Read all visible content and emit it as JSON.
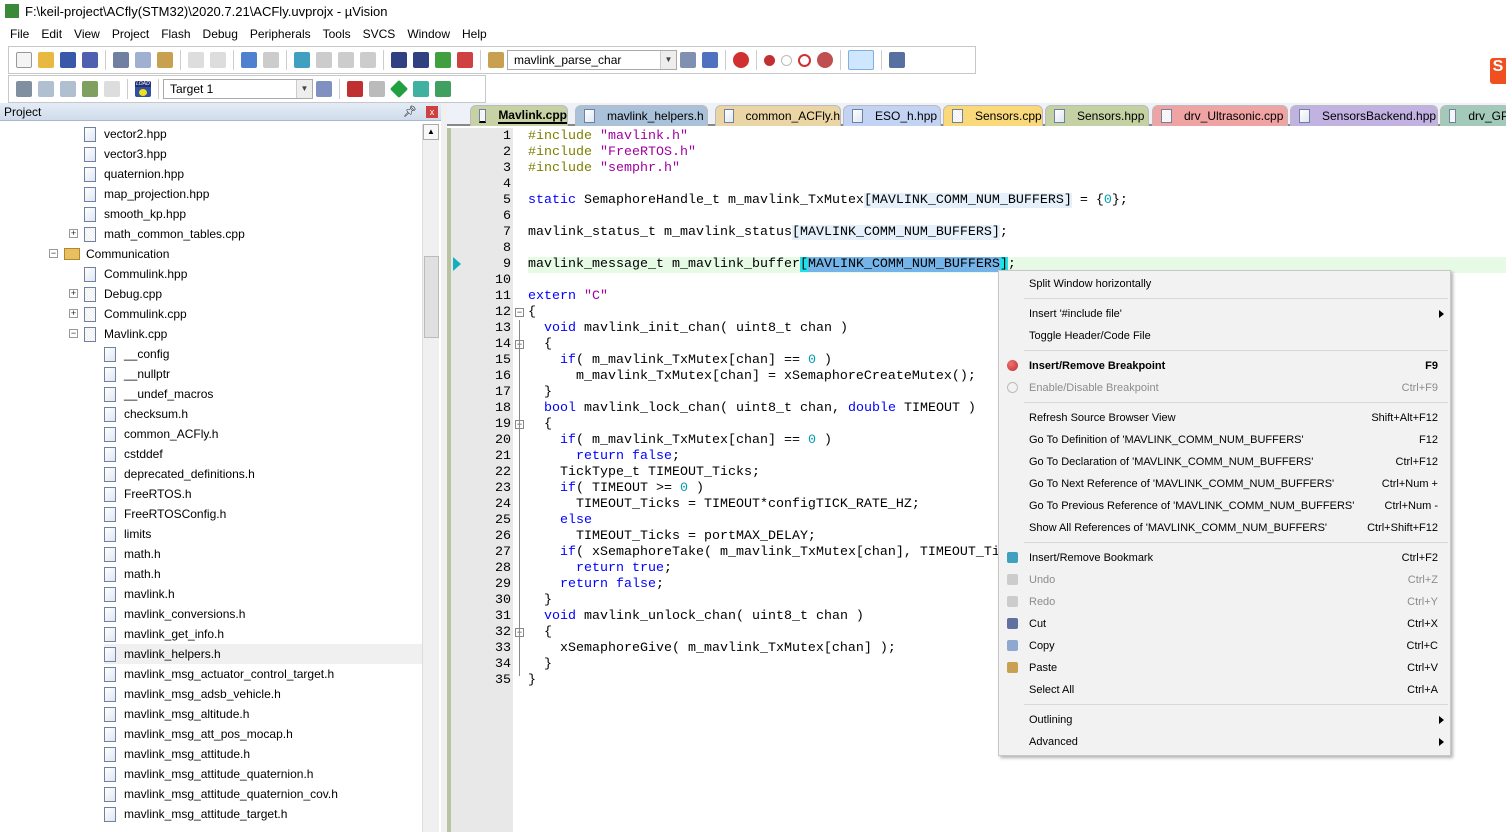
{
  "window": {
    "title": "F:\\keil-project\\ACfly(STM32)\\2020.7.21\\ACFly.uvprojx - µVision",
    "logo": "V"
  },
  "menu": [
    "File",
    "Edit",
    "View",
    "Project",
    "Flash",
    "Debug",
    "Peripherals",
    "Tools",
    "SVCS",
    "Window",
    "Help"
  ],
  "toolbar": {
    "find_combo": "mavlink_parse_char",
    "target_combo": "Target 1",
    "load_label": "LOAD"
  },
  "project": {
    "title": "Project",
    "pin": "ᵖ",
    "close": "x",
    "tree": [
      {
        "label": "vector2.hpp",
        "level": 2,
        "kind": "header"
      },
      {
        "label": "vector3.hpp",
        "level": 2,
        "kind": "header"
      },
      {
        "label": "quaternion.hpp",
        "level": 2,
        "kind": "header"
      },
      {
        "label": "map_projection.hpp",
        "level": 2,
        "kind": "header"
      },
      {
        "label": "smooth_kp.hpp",
        "level": 2,
        "kind": "header"
      },
      {
        "label": "math_common_tables.cpp",
        "level": 2,
        "kind": "source",
        "expander": "+"
      },
      {
        "label": "Communication",
        "level": 1,
        "kind": "folder",
        "expander": "-"
      },
      {
        "label": "Commulink.hpp",
        "level": 2,
        "kind": "header"
      },
      {
        "label": "Debug.cpp",
        "level": 2,
        "kind": "source",
        "expander": "+"
      },
      {
        "label": "Commulink.cpp",
        "level": 2,
        "kind": "source",
        "expander": "+"
      },
      {
        "label": "Mavlink.cpp",
        "level": 2,
        "kind": "source",
        "expander": "-"
      },
      {
        "label": "__config",
        "level": 3,
        "kind": "header"
      },
      {
        "label": "__nullptr",
        "level": 3,
        "kind": "header"
      },
      {
        "label": "__undef_macros",
        "level": 3,
        "kind": "header"
      },
      {
        "label": "checksum.h",
        "level": 3,
        "kind": "header"
      },
      {
        "label": "common_ACFly.h",
        "level": 3,
        "kind": "header"
      },
      {
        "label": "cstddef",
        "level": 3,
        "kind": "header"
      },
      {
        "label": "deprecated_definitions.h",
        "level": 3,
        "kind": "header"
      },
      {
        "label": "FreeRTOS.h",
        "level": 3,
        "kind": "header"
      },
      {
        "label": "FreeRTOSConfig.h",
        "level": 3,
        "kind": "header"
      },
      {
        "label": "limits",
        "level": 3,
        "kind": "header"
      },
      {
        "label": "math.h",
        "level": 3,
        "kind": "header"
      },
      {
        "label": "math.h",
        "level": 3,
        "kind": "header"
      },
      {
        "label": "mavlink.h",
        "level": 3,
        "kind": "header"
      },
      {
        "label": "mavlink_conversions.h",
        "level": 3,
        "kind": "header"
      },
      {
        "label": "mavlink_get_info.h",
        "level": 3,
        "kind": "header"
      },
      {
        "label": "mavlink_helpers.h",
        "level": 3,
        "kind": "header",
        "selected": true
      },
      {
        "label": "mavlink_msg_actuator_control_target.h",
        "level": 3,
        "kind": "header"
      },
      {
        "label": "mavlink_msg_adsb_vehicle.h",
        "level": 3,
        "kind": "header"
      },
      {
        "label": "mavlink_msg_altitude.h",
        "level": 3,
        "kind": "header"
      },
      {
        "label": "mavlink_msg_att_pos_mocap.h",
        "level": 3,
        "kind": "header"
      },
      {
        "label": "mavlink_msg_attitude.h",
        "level": 3,
        "kind": "header"
      },
      {
        "label": "mavlink_msg_attitude_quaternion.h",
        "level": 3,
        "kind": "header"
      },
      {
        "label": "mavlink_msg_attitude_quaternion_cov.h",
        "level": 3,
        "kind": "header"
      },
      {
        "label": "mavlink_msg_attitude_target.h",
        "level": 3,
        "kind": "header"
      }
    ]
  },
  "tabs": [
    {
      "label": "Mavlink.cpp",
      "color": "#c6d2a4",
      "active": true,
      "kind": "source"
    },
    {
      "label": "mavlink_helpers.h",
      "color": "#a9c1d9",
      "kind": "header"
    },
    {
      "label": "common_ACFly.h",
      "color": "#ead6a4",
      "kind": "header"
    },
    {
      "label": "ESO_h.hpp",
      "color": "#c3d3f3",
      "kind": "header"
    },
    {
      "label": "Sensors.cpp",
      "color": "#fad97a",
      "kind": "source"
    },
    {
      "label": "Sensors.hpp",
      "color": "#c3d1a3",
      "kind": "header"
    },
    {
      "label": "drv_Ultrasonic.cpp",
      "color": "#f0a3a3",
      "kind": "source"
    },
    {
      "label": "SensorsBackend.hpp",
      "color": "#c2b2e2",
      "kind": "header"
    },
    {
      "label": "drv_GP",
      "color": "#a3c9b9",
      "kind": "source"
    }
  ],
  "editor": {
    "current_line": 9,
    "folds": [
      12,
      14,
      19,
      32
    ],
    "lines": [
      [
        [
          "pp",
          "#include "
        ],
        [
          "str",
          "\"mavlink.h\""
        ]
      ],
      [
        [
          "pp",
          "#include "
        ],
        [
          "str",
          "\"FreeRTOS.h\""
        ]
      ],
      [
        [
          "pp",
          "#include "
        ],
        [
          "str",
          "\"semphr.h\""
        ]
      ],
      [],
      [
        [
          "kw",
          "static"
        ],
        [
          "pl",
          " SemaphoreHandle_t m_mavlink_TxMutex"
        ],
        [
          "hl",
          "[MAVLINK_COMM_NUM_BUFFERS]"
        ],
        [
          "pl",
          " = {"
        ],
        [
          "num",
          "0"
        ],
        [
          "pl",
          "};"
        ]
      ],
      [],
      [
        [
          "pl",
          "mavlink_status_t m_mavlink_status"
        ],
        [
          "hl",
          "[MAVLINK_COMM_NUM_BUFFERS]"
        ],
        [
          "pl",
          ";"
        ]
      ],
      [],
      [
        [
          "pl",
          "mavlink_message_t m_mavlink_buffer"
        ],
        [
          "br",
          "["
        ],
        [
          "sel",
          "MAVLINK_COMM_NUM_BUFFERS"
        ],
        [
          "br",
          "]"
        ],
        [
          "pl",
          ";"
        ]
      ],
      [],
      [
        [
          "kw",
          "extern"
        ],
        [
          "pl",
          " "
        ],
        [
          "str",
          "\"C\""
        ]
      ],
      [
        [
          "pl",
          "{"
        ]
      ],
      [
        [
          "pl",
          "  "
        ],
        [
          "kw",
          "void"
        ],
        [
          "pl",
          " mavlink_init_chan( uint8_t chan )"
        ]
      ],
      [
        [
          "pl",
          "  {"
        ]
      ],
      [
        [
          "pl",
          "    "
        ],
        [
          "kw",
          "if"
        ],
        [
          "pl",
          "( m_mavlink_TxMutex[chan] == "
        ],
        [
          "num",
          "0"
        ],
        [
          "pl",
          " )"
        ]
      ],
      [
        [
          "pl",
          "      m_mavlink_TxMutex[chan] = xSemaphoreCreateMutex();"
        ]
      ],
      [
        [
          "pl",
          "  }"
        ]
      ],
      [
        [
          "pl",
          "  "
        ],
        [
          "kw",
          "bool"
        ],
        [
          "pl",
          " mavlink_lock_chan( uint8_t chan, "
        ],
        [
          "kw",
          "double"
        ],
        [
          "pl",
          " TIMEOUT )"
        ]
      ],
      [
        [
          "pl",
          "  {"
        ]
      ],
      [
        [
          "pl",
          "    "
        ],
        [
          "kw",
          "if"
        ],
        [
          "pl",
          "( m_mavlink_TxMutex[chan] == "
        ],
        [
          "num",
          "0"
        ],
        [
          "pl",
          " )"
        ]
      ],
      [
        [
          "pl",
          "      "
        ],
        [
          "kw",
          "return false"
        ],
        [
          "pl",
          ";"
        ]
      ],
      [
        [
          "pl",
          "    TickType_t TIMEOUT_Ticks;"
        ]
      ],
      [
        [
          "pl",
          "    "
        ],
        [
          "kw",
          "if"
        ],
        [
          "pl",
          "( TIMEOUT >= "
        ],
        [
          "num",
          "0"
        ],
        [
          "pl",
          " )"
        ]
      ],
      [
        [
          "pl",
          "      TIMEOUT_Ticks = TIMEOUT*configTICK_RATE_HZ;"
        ]
      ],
      [
        [
          "pl",
          "    "
        ],
        [
          "kw",
          "else"
        ]
      ],
      [
        [
          "pl",
          "      TIMEOUT_Ticks = portMAX_DELAY;"
        ]
      ],
      [
        [
          "pl",
          "    "
        ],
        [
          "kw",
          "if"
        ],
        [
          "pl",
          "( xSemaphoreTake( m_mavlink_TxMutex[chan], TIMEOUT_Ticks ) )"
        ]
      ],
      [
        [
          "pl",
          "      "
        ],
        [
          "kw",
          "return true"
        ],
        [
          "pl",
          ";"
        ]
      ],
      [
        [
          "pl",
          "    "
        ],
        [
          "kw",
          "return false"
        ],
        [
          "pl",
          ";"
        ]
      ],
      [
        [
          "pl",
          "  }"
        ]
      ],
      [
        [
          "pl",
          "  "
        ],
        [
          "kw",
          "void"
        ],
        [
          "pl",
          " mavlink_unlock_chan( uint8_t chan )"
        ]
      ],
      [
        [
          "pl",
          "  {"
        ]
      ],
      [
        [
          "pl",
          "    xSemaphoreGive( m_mavlink_TxMutex[chan] );"
        ]
      ],
      [
        [
          "pl",
          "  }"
        ]
      ],
      [
        [
          "pl",
          "}"
        ]
      ]
    ]
  },
  "context_menu": [
    {
      "label": "Split Window horizontally"
    },
    {
      "sep": true
    },
    {
      "label": "Insert '#include file'",
      "submenu": true
    },
    {
      "label": "Toggle Header/Code File"
    },
    {
      "sep": true
    },
    {
      "label": "Insert/Remove Breakpoint",
      "shortcut": "F9",
      "bold": true,
      "icon": "breakpoint-icon"
    },
    {
      "label": "Enable/Disable Breakpoint",
      "shortcut": "Ctrl+F9",
      "disabled": true,
      "icon": "breakpoint-disabled-icon"
    },
    {
      "sep": true
    },
    {
      "label": "Refresh Source Browser View",
      "shortcut": "Shift+Alt+F12"
    },
    {
      "label": "Go To Definition of 'MAVLINK_COMM_NUM_BUFFERS'",
      "shortcut": "F12"
    },
    {
      "label": "Go To Declaration of 'MAVLINK_COMM_NUM_BUFFERS'",
      "shortcut": "Ctrl+F12"
    },
    {
      "label": "Go To Next Reference of 'MAVLINK_COMM_NUM_BUFFERS'",
      "shortcut": "Ctrl+Num +"
    },
    {
      "label": "Go To Previous Reference of 'MAVLINK_COMM_NUM_BUFFERS'",
      "shortcut": "Ctrl+Num -"
    },
    {
      "label": "Show All References of 'MAVLINK_COMM_NUM_BUFFERS'",
      "shortcut": "Ctrl+Shift+F12"
    },
    {
      "sep": true
    },
    {
      "label": "Insert/Remove Bookmark",
      "shortcut": "Ctrl+F2",
      "icon": "bookmark-icon"
    },
    {
      "label": "Undo",
      "shortcut": "Ctrl+Z",
      "disabled": true,
      "icon": "undo-icon"
    },
    {
      "label": "Redo",
      "shortcut": "Ctrl+Y",
      "disabled": true,
      "icon": "redo-icon"
    },
    {
      "label": "Cut",
      "shortcut": "Ctrl+X",
      "icon": "cut-icon"
    },
    {
      "label": "Copy",
      "shortcut": "Ctrl+C",
      "icon": "copy-icon"
    },
    {
      "label": "Paste",
      "shortcut": "Ctrl+V",
      "icon": "paste-icon"
    },
    {
      "label": "Select All",
      "shortcut": "Ctrl+A"
    },
    {
      "sep": true
    },
    {
      "label": "Outlining",
      "submenu": true
    },
    {
      "label": "Advanced",
      "submenu": true
    }
  ],
  "colors": {
    "active_line": "#e6fae6",
    "selection": "#74b4e8",
    "breakpoint": "#c03030",
    "bracket_match": "#20e0e8"
  }
}
